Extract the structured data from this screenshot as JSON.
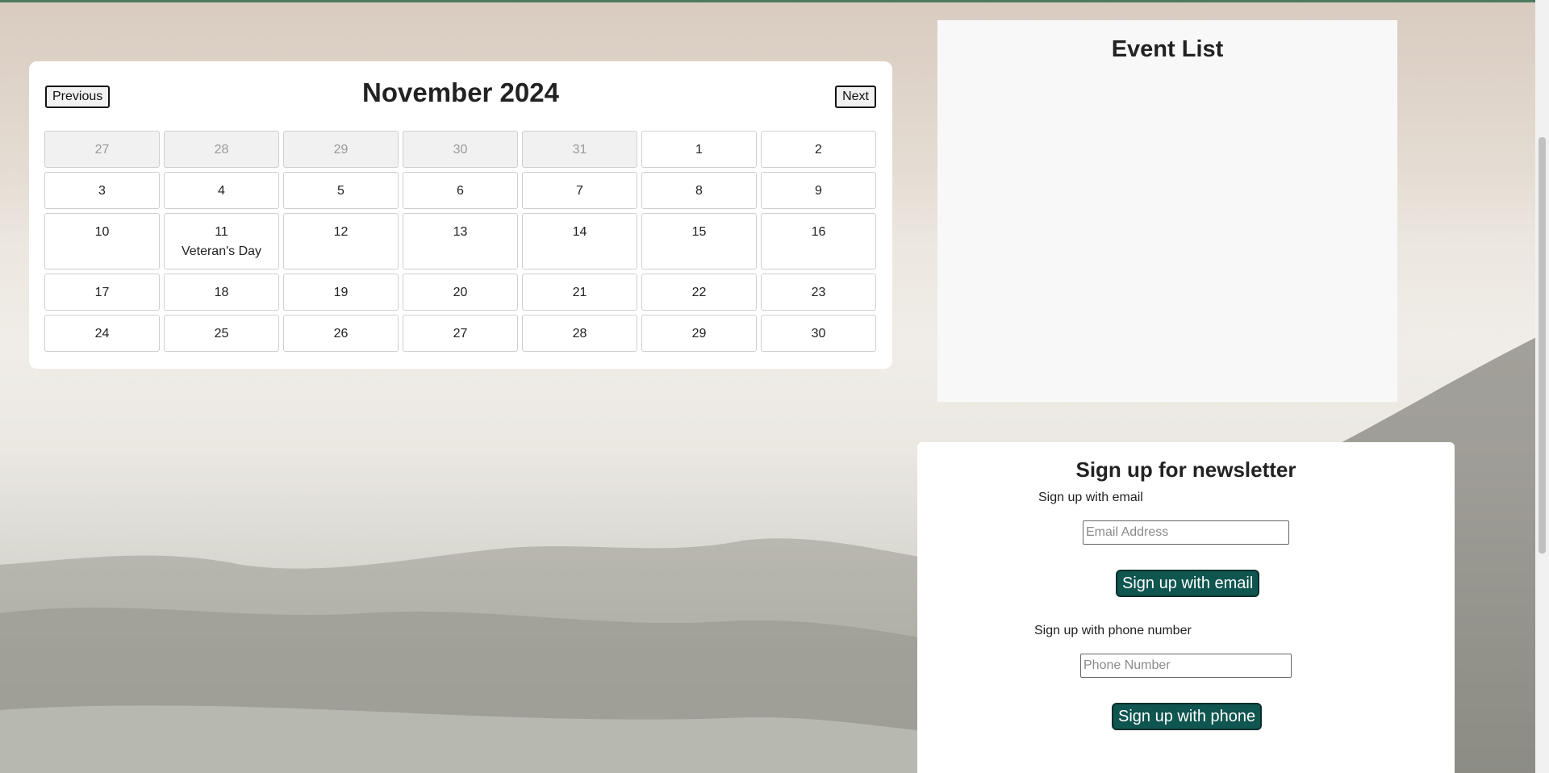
{
  "calendar": {
    "title": "November 2024",
    "prev_label": "Previous",
    "next_label": "Next",
    "weeks": [
      [
        {
          "day": "27",
          "other": true
        },
        {
          "day": "28",
          "other": true
        },
        {
          "day": "29",
          "other": true
        },
        {
          "day": "30",
          "other": true
        },
        {
          "day": "31",
          "other": true
        },
        {
          "day": "1"
        },
        {
          "day": "2"
        }
      ],
      [
        {
          "day": "3"
        },
        {
          "day": "4"
        },
        {
          "day": "5"
        },
        {
          "day": "6"
        },
        {
          "day": "7"
        },
        {
          "day": "8"
        },
        {
          "day": "9"
        }
      ],
      [
        {
          "day": "10"
        },
        {
          "day": "11",
          "event": "Veteran's Day"
        },
        {
          "day": "12"
        },
        {
          "day": "13"
        },
        {
          "day": "14"
        },
        {
          "day": "15"
        },
        {
          "day": "16"
        }
      ],
      [
        {
          "day": "17"
        },
        {
          "day": "18"
        },
        {
          "day": "19"
        },
        {
          "day": "20"
        },
        {
          "day": "21"
        },
        {
          "day": "22"
        },
        {
          "day": "23"
        }
      ],
      [
        {
          "day": "24"
        },
        {
          "day": "25"
        },
        {
          "day": "26"
        },
        {
          "day": "27"
        },
        {
          "day": "28"
        },
        {
          "day": "29"
        },
        {
          "day": "30"
        }
      ]
    ]
  },
  "event_list": {
    "title": "Event List"
  },
  "newsletter": {
    "title": "Sign up for newsletter",
    "email_label": "Sign up with email",
    "email_placeholder": "Email Address",
    "email_button": "Sign up with email",
    "phone_label": "Sign up with phone number",
    "phone_placeholder": "Phone Number",
    "phone_button": "Sign up with phone"
  },
  "colors": {
    "accent_bar": "#4d7a5e",
    "button_bg": "#0f5550",
    "other_month_bg": "#f1f1f1"
  }
}
